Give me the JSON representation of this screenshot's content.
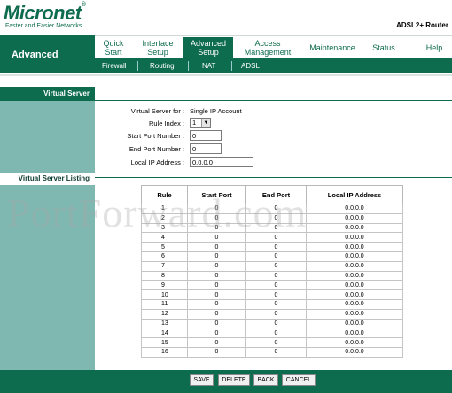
{
  "brand": {
    "logo": "Micronet",
    "registered": "®",
    "tagline": "Faster and Easier Networks",
    "product": "ADSL2+ Router"
  },
  "section": "Advanced",
  "tabs": [
    {
      "label": "Quick Start",
      "active": false
    },
    {
      "label": "Interface Setup",
      "active": false
    },
    {
      "label": "Advanced Setup",
      "active": true
    },
    {
      "label": "Access Management",
      "active": false
    },
    {
      "label": "Maintenance",
      "active": false
    },
    {
      "label": "Status",
      "active": false
    },
    {
      "label": "Help",
      "active": false
    }
  ],
  "subtabs": [
    "Firewall",
    "Routing",
    "NAT",
    "ADSL"
  ],
  "sidebar": {
    "virtual_server": "Virtual Server",
    "listing": "Virtual Server Listing"
  },
  "form": {
    "virtual_server_for_label": "Virtual Server for :",
    "virtual_server_for_value": "Single IP Account",
    "rule_index_label": "Rule Index :",
    "rule_index_value": "1",
    "start_port_label": "Start Port Number :",
    "start_port_value": "0",
    "end_port_label": "End Port Number :",
    "end_port_value": "0",
    "local_ip_label": "Local IP Address :",
    "local_ip_value": "0.0.0.0"
  },
  "table": {
    "headers": [
      "Rule",
      "Start Port",
      "End Port",
      "Local IP Address"
    ],
    "rows": [
      [
        "1",
        "0",
        "0",
        "0.0.0.0"
      ],
      [
        "2",
        "0",
        "0",
        "0.0.0.0"
      ],
      [
        "3",
        "0",
        "0",
        "0.0.0.0"
      ],
      [
        "4",
        "0",
        "0",
        "0.0.0.0"
      ],
      [
        "5",
        "0",
        "0",
        "0.0.0.0"
      ],
      [
        "6",
        "0",
        "0",
        "0.0.0.0"
      ],
      [
        "7",
        "0",
        "0",
        "0.0.0.0"
      ],
      [
        "8",
        "0",
        "0",
        "0.0.0.0"
      ],
      [
        "9",
        "0",
        "0",
        "0.0.0.0"
      ],
      [
        "10",
        "0",
        "0",
        "0.0.0.0"
      ],
      [
        "11",
        "0",
        "0",
        "0.0.0.0"
      ],
      [
        "12",
        "0",
        "0",
        "0.0.0.0"
      ],
      [
        "13",
        "0",
        "0",
        "0.0.0.0"
      ],
      [
        "14",
        "0",
        "0",
        "0.0.0.0"
      ],
      [
        "15",
        "0",
        "0",
        "0.0.0.0"
      ],
      [
        "16",
        "0",
        "0",
        "0.0.0.0"
      ]
    ]
  },
  "watermark": "PortForward.com",
  "buttons": {
    "save": "SAVE",
    "delete": "DELETE",
    "back": "BACK",
    "cancel": "CANCEL"
  },
  "colors": {
    "brand_green": "#0d6b4e",
    "sidebar_teal": "#7fb7b1"
  }
}
